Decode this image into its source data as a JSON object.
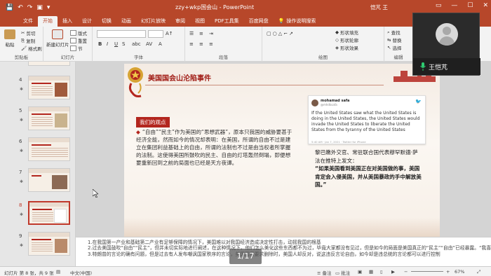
{
  "titlebar": {
    "doc_title": "zzy+wkp国会山 - PowerPoint",
    "user": "恺芃 王"
  },
  "ribbon_tabs": [
    "文件",
    "开始",
    "插入",
    "设计",
    "切换",
    "动画",
    "幻灯片放映",
    "审阅",
    "视图",
    "PDF工具集",
    "百度网盘"
  ],
  "tell_me": "操作说明搜索",
  "ribbon": {
    "clipboard": {
      "paste": "粘贴",
      "cut": "剪切",
      "copy": "复制",
      "format_painter": "格式刷",
      "label": "剪贴板"
    },
    "slides": {
      "new_slide": "新建幻灯片",
      "layout": "版式",
      "reset": "重置",
      "section": "节",
      "label": "幻灯片"
    },
    "font": {
      "bold": "B",
      "italic": "I",
      "underline": "U",
      "shadow": "S",
      "label": "字体"
    },
    "paragraph": {
      "label": "段落"
    },
    "drawing": {
      "shape_fill": "形状填充",
      "shape_outline": "形状轮廓",
      "shape_effects": "形状效果",
      "label": "绘图"
    },
    "editing": {
      "find": "查找",
      "replace": "替换",
      "select": "选择",
      "label": "编辑"
    }
  },
  "thumbnails": [
    {
      "num": "4"
    },
    {
      "num": "5"
    },
    {
      "num": "6"
    },
    {
      "num": "7"
    },
    {
      "num": "8"
    },
    {
      "num": "9"
    }
  ],
  "slide": {
    "title": "美国国会山沦陷事件",
    "callout_label": "我们的观点",
    "viewpoint": "“自由”“民主”作为美国的“思想武器”，原本只我国的威胁要甚于经济全能，然而如今的情况却表明：在美国，所谓的自由不过是建立在集团利益基础上的自由，所谓的法制也不过是由当权者所掌握的法制。这使得美国所鼓吹的民主、自由的灯塔轰然倒塌，即便想要重新回到之前的局面也已经是天方夜谭。",
    "tweet": {
      "name": "mohamad safa",
      "handle": "@mhdksafa",
      "body": "If the United States saw what the United States is doing in the United States, the United States would invade the United States to liberate the United States from the tyranny of the United States",
      "footer": "5:40 AM · Jan 7, 2021 · Twitter for iPhone"
    },
    "quote_intro": "黎巴嫩外交官、常驻联合国代表穆罕默德·萨法在推特上发文：",
    "quote_body": "“如果美国看到美国正在对美国做的事，美国肯定会入侵美国，并从美国暴政的手中解放美国。”"
  },
  "notes": [
    "1.在我国第一产业和基础第二产业有足够保障的情况下，美国难以对我国经济造成决定性打击，动摇我国的根基",
    "2.过去美国鼓吹“自由”“民主”，但并未切实际地进行阐述，在这种情况下，他们怎么美化这些东西都不为过，毕竟大家都没有见过，但是如今的局面是美国真正的“民主”“自由”已经暴露。“我喜欢的才是自由”",
    "3.特朗普的言论的确有问题，但是过去有人发布嘲讽国家秩序的言论，美国国家要求删除时，美国人却反对，说这违反言论自由，如今却是违总统的言论都可以进行控制"
  ],
  "pager": "1/17",
  "status": {
    "slide_info": "幻灯片 第 8 张，共 9 张",
    "language": "中文(中国)",
    "notes": "备注",
    "comments": "批注",
    "zoom": "67%"
  },
  "video": {
    "name": "王恺芃"
  }
}
